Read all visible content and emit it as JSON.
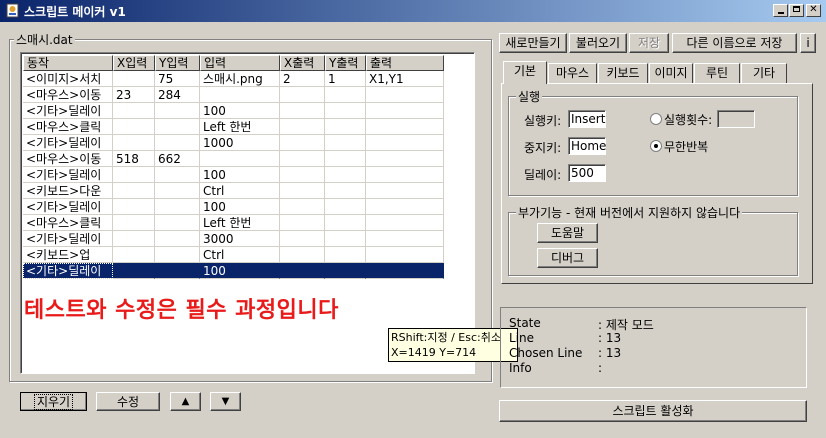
{
  "window": {
    "title": "스크립트 메이커 v1"
  },
  "list_group": {
    "label": "스매시.dat"
  },
  "table": {
    "columns": [
      "동작",
      "X입력",
      "Y입력",
      "입력",
      "X출력",
      "Y출력",
      "출력"
    ],
    "rows": [
      [
        "<이미지>서치",
        "",
        "75",
        "스매시.png",
        "2",
        "1",
        "X1,Y1"
      ],
      [
        "<마우스>이동",
        "23",
        "284",
        "",
        "",
        "",
        ""
      ],
      [
        "<기타>딜레이",
        "",
        "",
        "100",
        "",
        "",
        ""
      ],
      [
        "<마우스>클릭",
        "",
        "",
        "Left 한번",
        "",
        "",
        ""
      ],
      [
        "<기타>딜레이",
        "",
        "",
        "1000",
        "",
        "",
        ""
      ],
      [
        "<마우스>이동",
        "518",
        "662",
        "",
        "",
        "",
        ""
      ],
      [
        "<기타>딜레이",
        "",
        "",
        "100",
        "",
        "",
        ""
      ],
      [
        "<키보드>다운",
        "",
        "",
        "Ctrl",
        "",
        "",
        ""
      ],
      [
        "<기타>딜레이",
        "",
        "",
        "100",
        "",
        "",
        ""
      ],
      [
        "<마우스>클릭",
        "",
        "",
        "Left 한번",
        "",
        "",
        ""
      ],
      [
        "<기타>딜레이",
        "",
        "",
        "3000",
        "",
        "",
        ""
      ],
      [
        "<키보드>업",
        "",
        "",
        "Ctrl",
        "",
        "",
        ""
      ],
      [
        "<기타>딜레이",
        "",
        "",
        "100",
        "",
        "",
        ""
      ]
    ],
    "selected_row": 12
  },
  "notice": "테스트와 수정은 필수 과정입니다",
  "tooltip": {
    "line1": "RShift:지정 / Esc:취소",
    "line2": "X=1419 Y=714"
  },
  "bottom_buttons": {
    "delete": "지우기",
    "edit": "수정",
    "up": "▲",
    "down": "▼"
  },
  "top_buttons": {
    "new": "새로만들기",
    "load": "불러오기",
    "save": "저장",
    "save_as": "다른 이름으로 저장",
    "info": "i"
  },
  "tabs": [
    "기본",
    "마우스",
    "키보드",
    "이미지",
    "루틴",
    "기타"
  ],
  "run_group": {
    "label": "실행",
    "run_key_label": "실행키:",
    "run_key_value": "Insert",
    "stop_key_label": "중지키:",
    "stop_key_value": "Home",
    "delay_label": "딜레이:",
    "delay_value": "500",
    "run_count_label": "실행횟수:",
    "run_count_value": "",
    "infinite_label": "무한반복"
  },
  "addon_group": {
    "label": "부가기능 - 현재 버전에서 지원하지 않습니다",
    "help": "도움말",
    "debug": "디버그"
  },
  "status": {
    "state_label": "State",
    "state_value": ": 제작 모드",
    "line_label": "Line",
    "line_value": ": 13",
    "chosen_label": "Chosen Line",
    "chosen_value": ": 13",
    "info_label": "Info",
    "info_value": ":"
  },
  "activate_button": "스크립트 활성화"
}
